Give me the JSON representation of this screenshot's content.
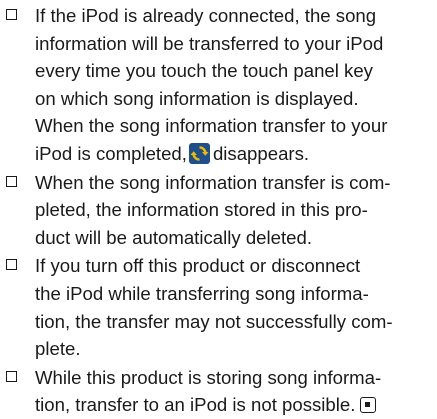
{
  "notes": [
    {
      "lines": [
        "If the iPod is already connected, the song",
        "information will be transferred to your iPod",
        "every time you touch the touch panel key",
        "on which song information is displayed.",
        "When the song information transfer to your",
        "iPod is completed,",
        "disappears."
      ]
    },
    {
      "lines": [
        "When the song information transfer is com-",
        "pleted, the information stored in this pro-",
        "duct will be automatically deleted."
      ]
    },
    {
      "lines": [
        "If you turn off this product or disconnect",
        "the iPod while transferring song informa-",
        "tion, the transfer may not successfully com-",
        "plete."
      ]
    },
    {
      "lines": [
        "While this product is storing song informa-",
        "tion, transfer to an iPod is not possible."
      ]
    }
  ],
  "icons": {
    "bullet": "checkbox-icon",
    "transfer": "song-transfer-icon",
    "end": "end-mark-icon"
  },
  "colors": {
    "text": "#1a1a1a",
    "transfer_icon_fill": "#f2b800",
    "transfer_icon_bg": "#1e4f8a"
  }
}
